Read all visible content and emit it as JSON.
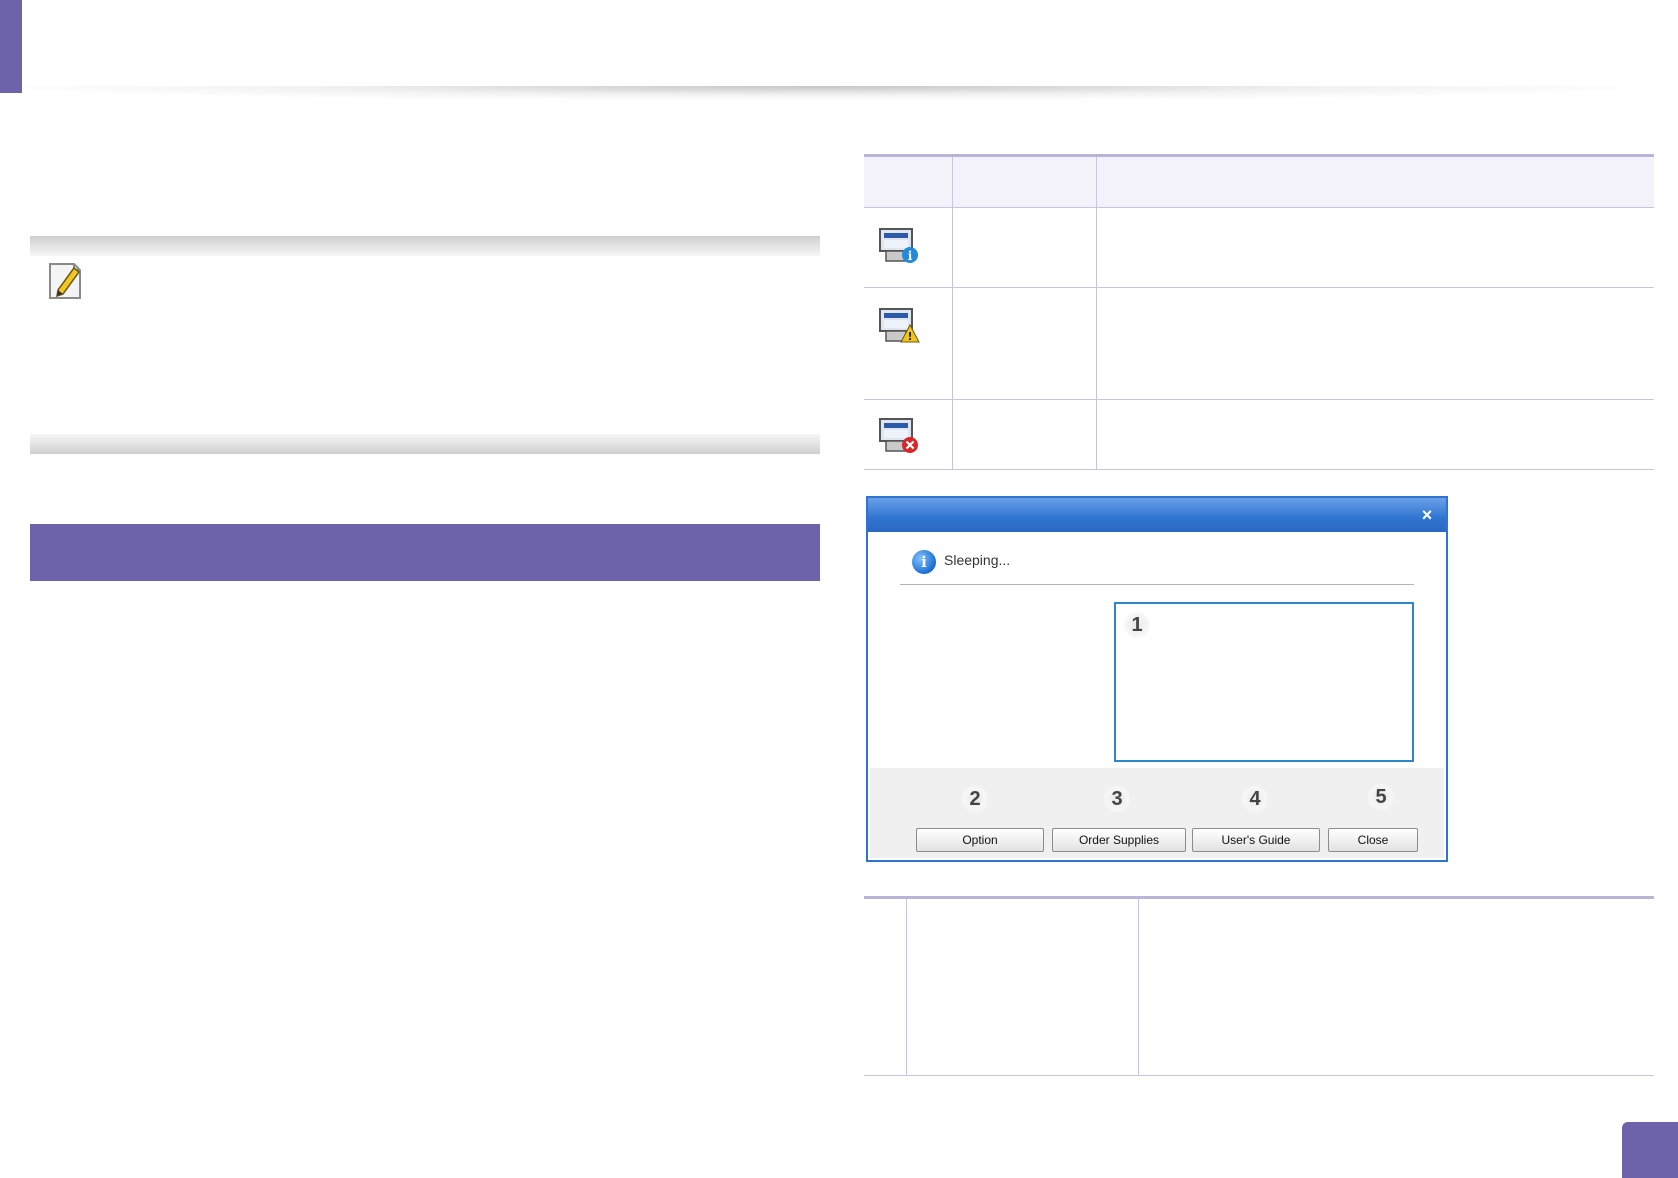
{
  "colors": {
    "brand_purple": "#6c63ab",
    "table_rule": "#b9b4d8",
    "dialog_blue": "#2f74d0"
  },
  "note": {
    "icon": "note-pencil-icon"
  },
  "status_table": {
    "rows": [
      {
        "icon": "printer-info-icon"
      },
      {
        "icon": "printer-warning-icon"
      },
      {
        "icon": "printer-error-icon"
      }
    ]
  },
  "dialog": {
    "close_glyph": "×",
    "status_icon": "info-icon",
    "status_icon_glyph": "i",
    "status_text": "Sleeping...",
    "buttons": [
      {
        "label": "Option",
        "callout": "2"
      },
      {
        "label": "Order Supplies",
        "callout": "3"
      },
      {
        "label": "User's Guide",
        "callout": "4"
      },
      {
        "label": "Close",
        "callout": "5"
      }
    ],
    "panel_callout": "1"
  }
}
